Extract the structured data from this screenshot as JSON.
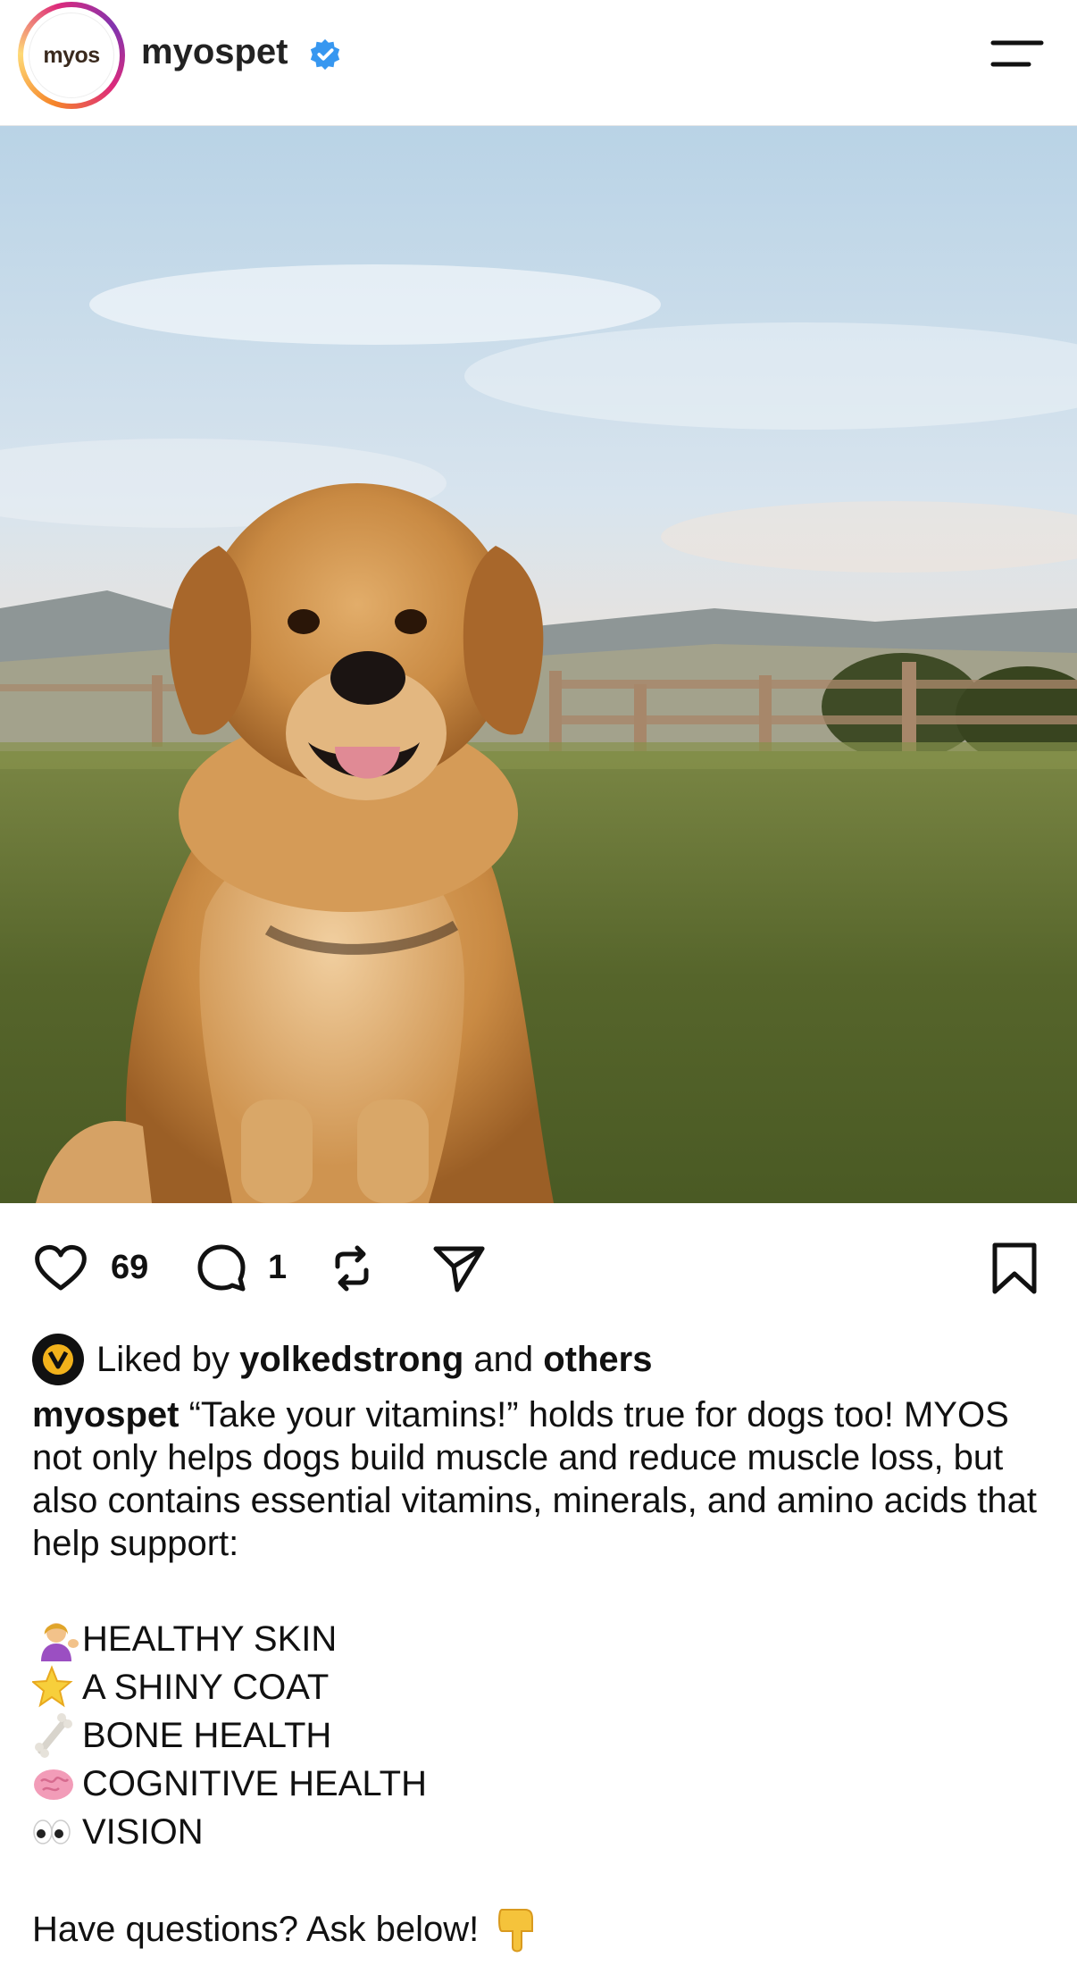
{
  "header": {
    "avatar_text": "myos",
    "username": "myospet",
    "verified_icon": "verified-badge-icon",
    "menu_icon": "menu-icon"
  },
  "post": {
    "image_description_icon": "dog-photo"
  },
  "actions": {
    "like_count": "69",
    "comment_count": "1",
    "icons": [
      "heart-icon",
      "comment-icon",
      "repost-icon",
      "send-icon",
      "bookmark-icon"
    ]
  },
  "likes": {
    "prefix": "Liked by ",
    "user": "yolkedstrong",
    "middle": " and ",
    "others": "others"
  },
  "caption": {
    "username": "myospet",
    "text": " “Take your vitamins!” holds true for dogs too! MYOS not only helps dogs build muscle and reduce muscle loss, but also contains essential vitamins, minerals, and amino acids that help support:",
    "list": [
      {
        "emoji": "person-tipping-hand-emoji",
        "text": "HEALTHY SKIN"
      },
      {
        "emoji": "star-emoji",
        "text": "A SHINY COAT"
      },
      {
        "emoji": "bone-emoji",
        "text": "BONE HEALTH"
      },
      {
        "emoji": "brain-emoji",
        "text": "COGNITIVE HEALTH"
      },
      {
        "emoji": "eyes-emoji",
        "text": "VISION"
      }
    ],
    "questions": "Have questions? Ask below!",
    "questions_emoji": "pointing-down-emoji"
  },
  "colors": {
    "verified": "#3797f0",
    "text": "#111111",
    "grass": "#5f6b32",
    "sky": "#c8dcea",
    "dog_fur": "#c98a43"
  }
}
